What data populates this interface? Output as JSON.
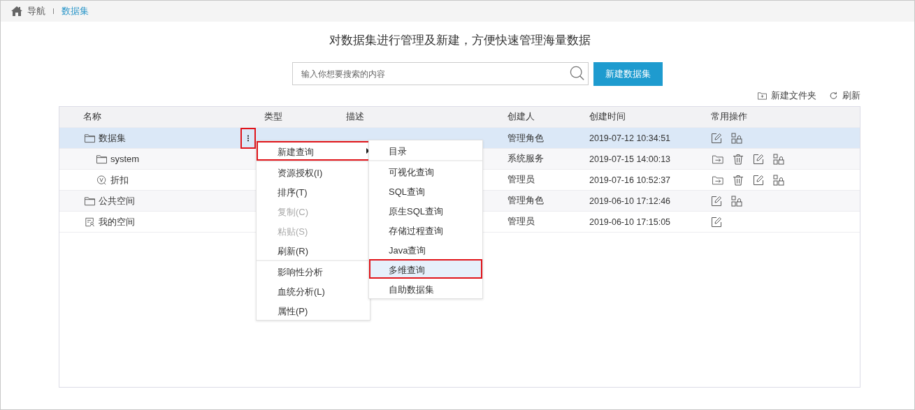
{
  "breadcrumb": {
    "home": "导航",
    "current": "数据集"
  },
  "heading": "对数据集进行管理及新建，方便快速管理海量数据",
  "search": {
    "placeholder": "输入你想要搜索的内容"
  },
  "create_button": "新建数据集",
  "toolbar": [
    {
      "kind": "new-folder",
      "label": "新建文件夹"
    },
    {
      "kind": "refresh",
      "label": "刷新"
    }
  ],
  "table": {
    "columns": [
      "名称",
      "类型",
      "描述",
      "创建人",
      "创建时间",
      "常用操作"
    ],
    "rows": [
      {
        "name": "数据集",
        "kind": "folder",
        "selected": true,
        "more_highlighted": true,
        "creator": "管理角色",
        "created": "2019-07-12 10:34:51",
        "actions": [
          {
            "kind": "edit"
          },
          {
            "kind": "authorize"
          }
        ],
        "children": [
          {
            "name": "system",
            "kind": "folder",
            "selected": false,
            "creator": "系统服务",
            "created": "2019-07-15 14:00:13",
            "actions": [
              {
                "kind": "move"
              },
              {
                "kind": "delete"
              },
              {
                "kind": "edit"
              },
              {
                "kind": "authorize"
              }
            ]
          },
          {
            "name": "折扣",
            "kind": "query",
            "selected": false,
            "creator": "管理员",
            "created": "2019-07-16 10:52:37",
            "actions": [
              {
                "kind": "move"
              },
              {
                "kind": "delete"
              },
              {
                "kind": "edit"
              },
              {
                "kind": "authorize"
              }
            ]
          }
        ]
      },
      {
        "name": "公共空间",
        "kind": "folder",
        "selected": false,
        "creator": "管理角色",
        "created": "2019-06-10 17:12:46",
        "actions": [
          {
            "kind": "edit"
          },
          {
            "kind": "authorize"
          }
        ]
      },
      {
        "name": "我的空间",
        "kind": "personal",
        "selected": false,
        "creator": "管理员",
        "created": "2019-06-10 17:15:05",
        "actions": [
          {
            "kind": "edit"
          }
        ]
      }
    ]
  },
  "context_menu": {
    "groups": [
      [
        {
          "label": "新建查询",
          "disabled": false,
          "submenu": true,
          "highlighted": true
        }
      ],
      [
        {
          "label": "资源授权(I)",
          "disabled": false,
          "submenu": false,
          "highlighted": false
        },
        {
          "label": "排序(T)",
          "disabled": false,
          "submenu": false,
          "highlighted": false
        },
        {
          "label": "复制(C)",
          "disabled": true,
          "submenu": false,
          "highlighted": false
        },
        {
          "label": "粘贴(S)",
          "disabled": true,
          "submenu": false,
          "highlighted": false
        },
        {
          "label": "刷新(R)",
          "disabled": false,
          "submenu": false,
          "highlighted": false
        }
      ],
      [
        {
          "label": "影响性分析",
          "disabled": false,
          "submenu": false,
          "highlighted": false
        },
        {
          "label": "血统分析(L)",
          "disabled": false,
          "submenu": false,
          "highlighted": false
        },
        {
          "label": "属性(P)",
          "disabled": false,
          "submenu": false,
          "highlighted": false
        }
      ]
    ]
  },
  "submenu": {
    "groups": [
      [
        {
          "label": "目录",
          "selected": false,
          "highlighted": false
        }
      ],
      [
        {
          "label": "可视化查询",
          "selected": false,
          "highlighted": false
        },
        {
          "label": "SQL查询",
          "selected": false,
          "highlighted": false
        },
        {
          "label": "原生SQL查询",
          "selected": false,
          "highlighted": false
        },
        {
          "label": "存储过程查询",
          "selected": false,
          "highlighted": false
        },
        {
          "label": "Java查询",
          "selected": false,
          "highlighted": false
        },
        {
          "label": "多维查询",
          "selected": true,
          "highlighted": true
        },
        {
          "label": "自助数据集",
          "selected": false,
          "highlighted": false
        }
      ]
    ]
  }
}
